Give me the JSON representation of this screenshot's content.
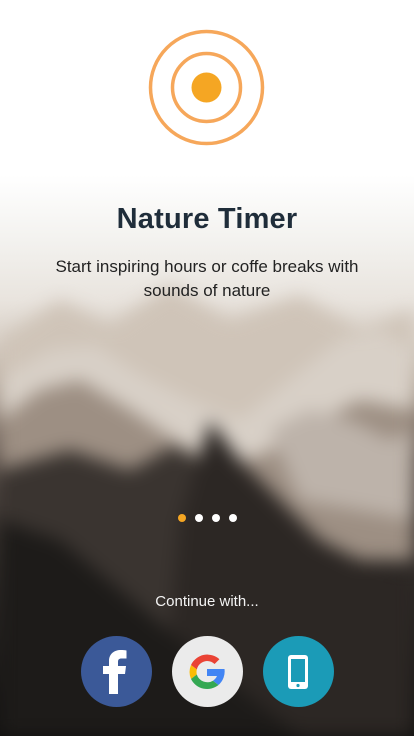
{
  "app": {
    "title": "Nature Timer",
    "subtitle": "Start inspiring hours or coffe breaks with sounds of nature"
  },
  "pager": {
    "total_pages": 4,
    "active_index": 0
  },
  "auth": {
    "prompt": "Continue with...",
    "options": [
      {
        "id": "facebook",
        "icon": "facebook-icon",
        "color": "#3b5998"
      },
      {
        "id": "google",
        "icon": "google-icon",
        "color": "#e8e8e8"
      },
      {
        "id": "phone",
        "icon": "phone-icon",
        "color": "#1b9bb7"
      }
    ]
  },
  "colors": {
    "accent": "#f5a623",
    "title": "#1f2d3a"
  }
}
